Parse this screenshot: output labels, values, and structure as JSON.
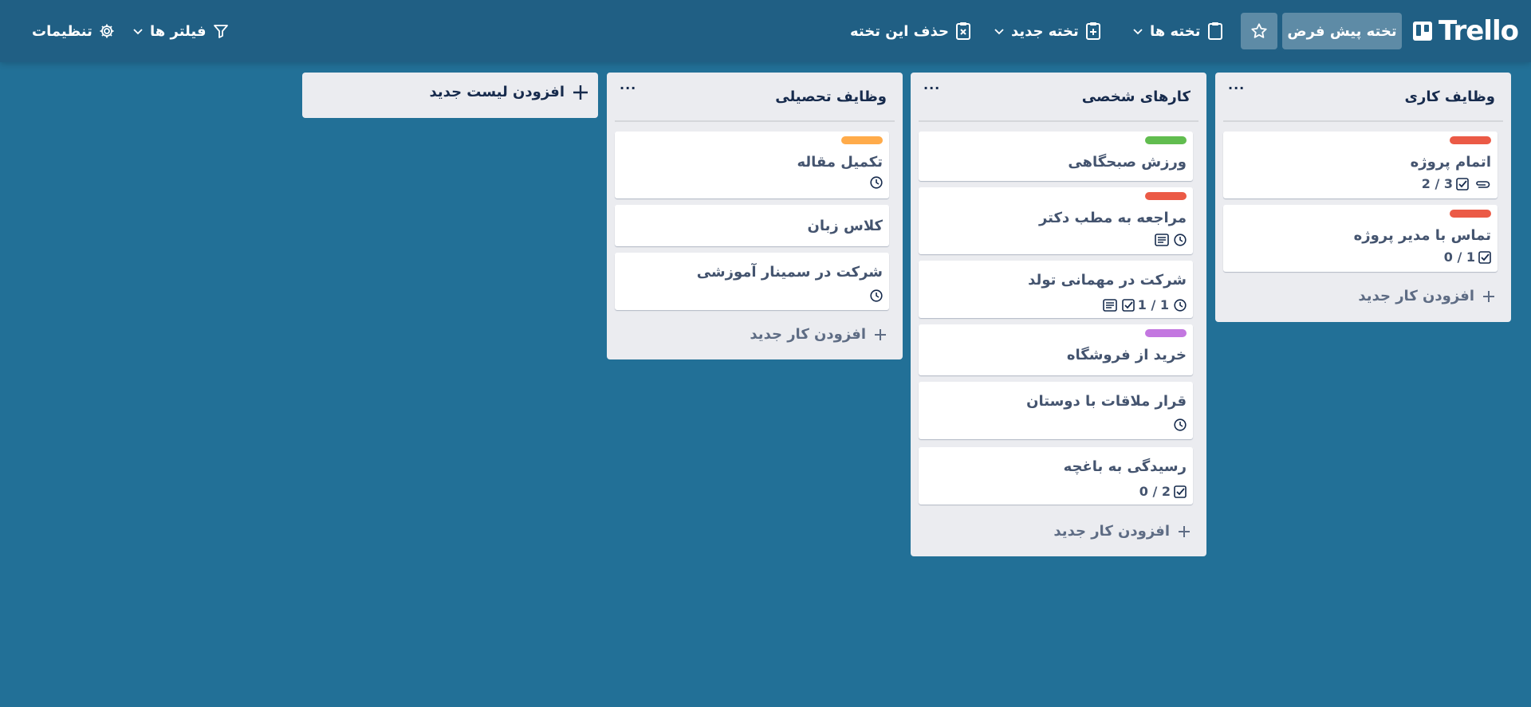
{
  "header": {
    "logo_text": "Trello",
    "board_select_label": "تخته پیش فرض",
    "boards_label": "تخته ها",
    "new_board_label": "تخته جدید",
    "delete_board_label": "حذف این تخته",
    "filters_label": "فیلتر ها",
    "settings_label": "تنظیمات"
  },
  "lists": [
    {
      "title": "وظایف کاری",
      "menu": "···",
      "add_card_label": "افزودن کار جدید",
      "cards": [
        {
          "title": "اتمام پروژه",
          "label_color": "#eb5a46",
          "checklist": "2 / 3",
          "attachment": true
        },
        {
          "title": "تماس با مدیر پروژه",
          "label_color": "#eb5a46",
          "checklist": "0 / 1"
        }
      ]
    },
    {
      "title": "کارهای شخصی",
      "menu": "···",
      "add_card_label": "افزودن کار جدید",
      "cards": [
        {
          "title": "ورزش صبحگاهی",
          "label_color": "#61bd4f"
        },
        {
          "title": "مراجعه به مطب دکتر",
          "label_color": "#eb5a46",
          "due": true,
          "description": true
        },
        {
          "title": "شرکت در مهمانی تولد",
          "checklist": "1 / 1",
          "due": true,
          "description": true
        },
        {
          "title": "خرید از فروشگاه",
          "label_color": "#c377e0"
        },
        {
          "title": "قرار ملاقات با دوستان",
          "due": true
        },
        {
          "title": "رسیدگی به باغچه",
          "checklist": "0 / 2"
        }
      ]
    },
    {
      "title": "وظایف تحصیلی",
      "menu": "···",
      "add_card_label": "افزودن کار جدید",
      "cards": [
        {
          "title": "تکمیل مقاله",
          "label_color": "#ffab4a",
          "due": true
        },
        {
          "title": "کلاس زبان"
        },
        {
          "title": "شرکت در سمینار آموزشی",
          "due": true
        }
      ]
    }
  ],
  "add_list_label": "افزودن لیست جدید",
  "icons": {
    "logo": "trello-logo-icon",
    "star": "star-icon",
    "board": "clipboard-icon",
    "new_board": "clipboard-plus-icon",
    "delete_board": "clipboard-x-icon",
    "filter": "filter-icon",
    "settings": "gear-icon",
    "checklist": "checkbox-icon",
    "due": "clock-icon",
    "description": "description-icon",
    "attachment": "paperclip-icon",
    "add": "plus-icon"
  },
  "colors": {
    "background": "#227097",
    "header": "#205f84",
    "list": "#ebecf0"
  }
}
